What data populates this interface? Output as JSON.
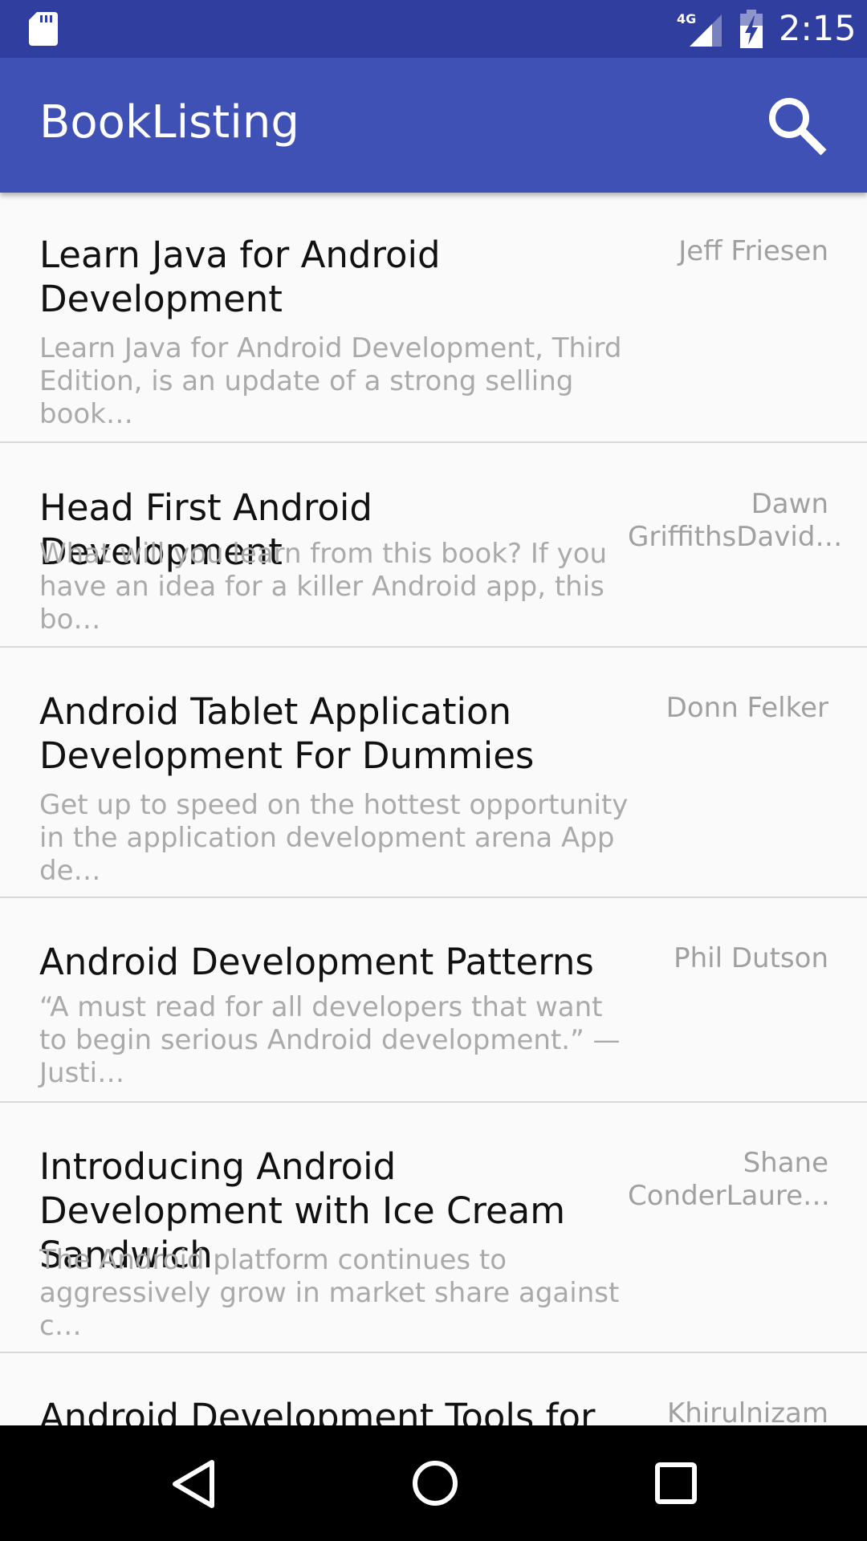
{
  "status_bar": {
    "network": "4G",
    "time": "2:15",
    "icons": [
      "sd-card-icon",
      "signal-icon",
      "battery-charging-icon"
    ]
  },
  "app_bar": {
    "title": "BookListing",
    "icons": [
      "search-icon"
    ]
  },
  "books": [
    {
      "title": "Learn Java for Android Development",
      "description": "Learn Java for Android Development, Third Edition, is an update of a strong selling book…",
      "author": "Jeff Friesen"
    },
    {
      "title": "Head First Android Development",
      "description": "What will you learn from this book? If you have an idea for a killer Android app, this bo…",
      "author": "Dawn GriffithsDavid…"
    },
    {
      "title": "Android Tablet Application Development For Dummies",
      "description": "Get up to speed on the hottest opportunity in the application development arena App de…",
      "author": "Donn Felker"
    },
    {
      "title": "Android Development Patterns",
      "description": "“A must read for all developers that want to begin serious Android development.” —Justi…",
      "author": "Phil Dutson"
    },
    {
      "title": "Introducing Android Development with Ice Cream Sandwich",
      "description": "The Android platform continues to aggressively grow in market share against c…",
      "author": "Shane ConderLaure…"
    },
    {
      "title": "Android Development Tools for",
      "description": "",
      "author": "Khirulnizam"
    }
  ],
  "nav_bar": {
    "icons": [
      "back-icon",
      "home-icon",
      "recents-icon"
    ]
  },
  "colors": {
    "status_bar": "#303f9f",
    "app_bar": "#3f51b5",
    "background": "#fafafa",
    "title_text": "#111111",
    "secondary_text": "#aaaaaa",
    "divider": "#d9d9d9",
    "nav_bar": "#000000"
  }
}
